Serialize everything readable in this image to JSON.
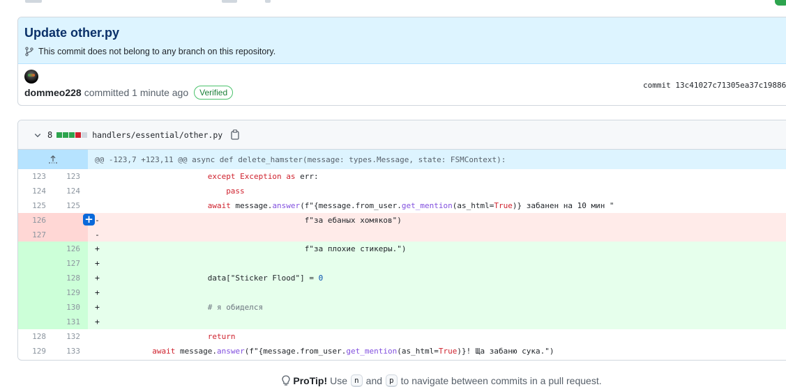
{
  "commit": {
    "title": "Update other.py",
    "branch_note": "This commit does not belong to any branch on this repository.",
    "author": "dommeo228",
    "action": "committed",
    "time": "1 minute ago",
    "verified_label": "Verified",
    "sha_label": "commit 13c41027c71305ea37c19886"
  },
  "file": {
    "changes": "8",
    "diffstat": [
      "add",
      "add",
      "add",
      "del",
      "neutral"
    ],
    "path": "handlers/essential/other.py",
    "hunk_header": "@@ -123,7 +123,11 @@ async def delete_hamster(message: types.Message, state: FSMContext):"
  },
  "diff_lines": [
    {
      "type": "ctx",
      "old": "123",
      "new": "123",
      "sign": "",
      "code": "                      except Exception as err:"
    },
    {
      "type": "ctx",
      "old": "124",
      "new": "124",
      "sign": "",
      "code": "                          pass"
    },
    {
      "type": "ctx",
      "old": "125",
      "new": "125",
      "sign": "",
      "code": "                      await message.answer(f\"{message.from_user.get_mention(as_html=True)} забанен на 10 мин \""
    },
    {
      "type": "del",
      "old": "126",
      "new": "",
      "sign": "-",
      "code": "                                           f\"за ебаных хомяков\")"
    },
    {
      "type": "del",
      "old": "127",
      "new": "",
      "sign": "-",
      "code": ""
    },
    {
      "type": "add",
      "old": "",
      "new": "126",
      "sign": "+",
      "code": "                                           f\"за плохие стикеры.\")"
    },
    {
      "type": "add",
      "old": "",
      "new": "127",
      "sign": "+",
      "code": ""
    },
    {
      "type": "add",
      "old": "",
      "new": "128",
      "sign": "+",
      "code": "                      data[\"Sticker Flood\"] = 0"
    },
    {
      "type": "add",
      "old": "",
      "new": "129",
      "sign": "+",
      "code": ""
    },
    {
      "type": "add",
      "old": "",
      "new": "130",
      "sign": "+",
      "code": "                      # я обиделся"
    },
    {
      "type": "add",
      "old": "",
      "new": "131",
      "sign": "+",
      "code": ""
    },
    {
      "type": "ctx",
      "old": "128",
      "new": "132",
      "sign": "",
      "code": "                      return"
    },
    {
      "type": "ctx",
      "old": "129",
      "new": "133",
      "sign": "",
      "code": "          await message.answer(f\"{message.from_user.get_mention(as_html=True)}! Ща забаню сука.\")"
    }
  ],
  "protip": {
    "label": "ProTip!",
    "use": "Use",
    "key_n": "n",
    "and": "and",
    "key_p": "p",
    "rest": "to navigate between commits in a pull request."
  },
  "colors": {
    "header_bg": "#ddf4ff",
    "add_bg": "#e6ffec",
    "del_bg": "#ffebe9",
    "verified": "#1a7f37",
    "accent": "#0969da"
  }
}
